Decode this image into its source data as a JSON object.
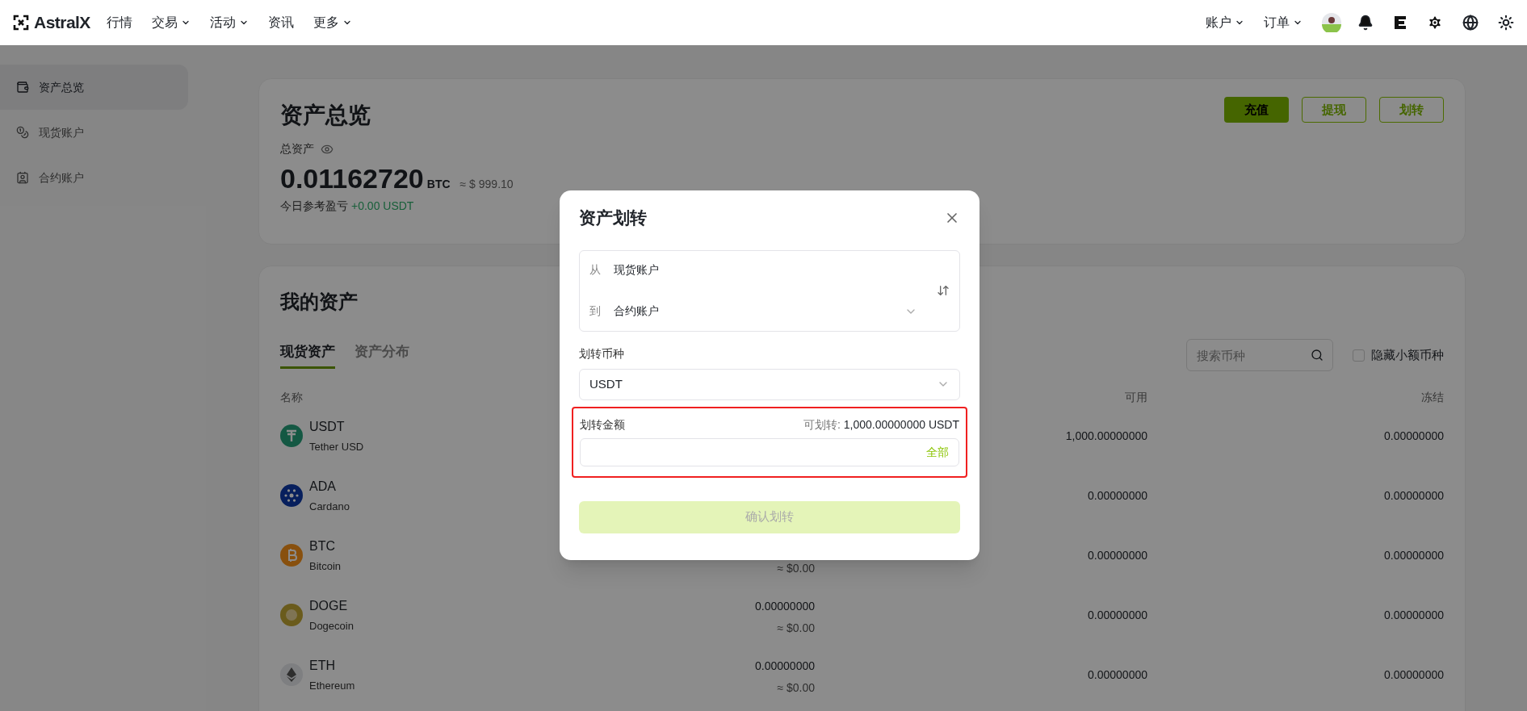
{
  "header": {
    "logo": "AstralX",
    "nav": [
      {
        "label": "行情",
        "dropdown": false
      },
      {
        "label": "交易",
        "dropdown": true
      },
      {
        "label": "活动",
        "dropdown": true
      },
      {
        "label": "资讯",
        "dropdown": false
      },
      {
        "label": "更多",
        "dropdown": true
      }
    ],
    "menus": [
      {
        "label": "账户"
      },
      {
        "label": "订单"
      }
    ]
  },
  "sidebar": {
    "items": [
      {
        "label": "资产总览",
        "selected": true
      },
      {
        "label": "现货账户",
        "selected": false
      },
      {
        "label": "合约账户",
        "selected": false
      }
    ]
  },
  "overview": {
    "title": "资产总览",
    "buttons": [
      {
        "label": "充值",
        "kind": "primary"
      },
      {
        "label": "提现",
        "kind": "outline"
      },
      {
        "label": "划转",
        "kind": "outline"
      }
    ],
    "total_label": "总资产",
    "total_value": "0.01162720",
    "total_unit": "BTC",
    "total_approx": "≈ $ 999.10",
    "pnl_label": "今日参考盈亏",
    "pnl_value": "+0.00 USDT"
  },
  "assets": {
    "title": "我的资产",
    "tabs": [
      {
        "label": "现货资产",
        "selected": true
      },
      {
        "label": "资产分布",
        "selected": false
      }
    ],
    "search": {
      "placeholder": "搜索币种"
    },
    "hide_small": {
      "label": "隐藏小额币种",
      "checked": false
    },
    "columns": [
      "名称",
      "可用",
      "冻结"
    ],
    "rows": [
      {
        "symbol": "USDT",
        "name": "Tether USD",
        "available": "1,000.00000000",
        "frozen": "0.00000000"
      },
      {
        "symbol": "ADA",
        "name": "Cardano",
        "available": "0.00000000",
        "frozen": "0.00000000"
      },
      {
        "symbol": "BTC",
        "name": "Bitcoin",
        "total_approx": "≈ $0.00",
        "available": "0.00000000",
        "frozen": "0.00000000"
      },
      {
        "symbol": "DOGE",
        "name": "Dogecoin",
        "total": "0.00000000",
        "total_approx": "≈ $0.00",
        "available": "0.00000000",
        "frozen": "0.00000000"
      },
      {
        "symbol": "ETH",
        "name": "Ethereum",
        "total": "0.00000000",
        "total_approx": "≈ $0.00",
        "available": "0.00000000",
        "frozen": "0.00000000"
      }
    ]
  },
  "modal": {
    "title": "资产划转",
    "from_label": "从",
    "from_value": "现货账户",
    "to_label": "到",
    "to_value": "合约账户",
    "coin_label": "划转币种",
    "coin_value": "USDT",
    "amount_label": "划转金额",
    "available_label": "可划转:",
    "available_value": "1,000.00000000 USDT",
    "max_link": "全部",
    "highlighted": true,
    "confirm": {
      "label": "确认划转",
      "disabled": true
    }
  }
}
